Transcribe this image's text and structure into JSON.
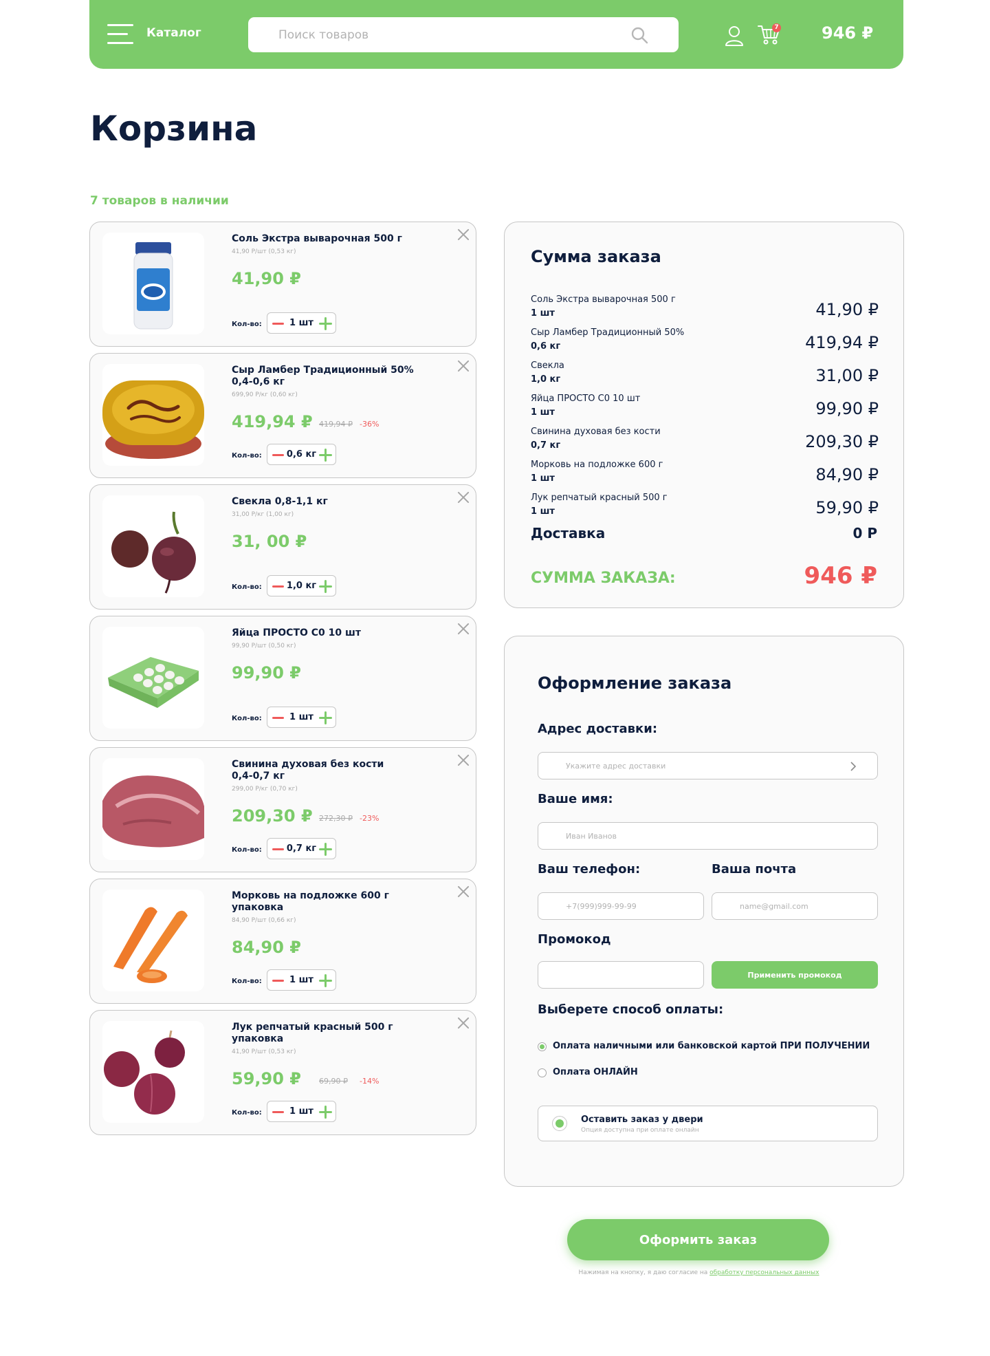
{
  "header": {
    "catalog_label": "Каталог",
    "search_placeholder": "Поиск товаров",
    "cart_count": "7",
    "total": "946 ₽"
  },
  "page": {
    "title": "Корзина",
    "stock_text": "7 товаров в наличии"
  },
  "cart": {
    "qty_label": "Кол-во:",
    "items": [
      {
        "name": "Соль Экстра выварочная 500 г",
        "subline": "",
        "unit": "41,90 Р/шт (0,53 кг)",
        "price": "41,90 ₽",
        "old_price": "",
        "discount": "",
        "qty": "1 шт"
      },
      {
        "name": "Сыр Ламбер Традиционный 50%",
        "subline": "0,4-0,6 кг",
        "unit": "699,90 Р/кг (0,60 кг)",
        "price": "419,94 ₽",
        "old_price": "419,94 ₽",
        "discount": "-36%",
        "qty": "0,6 кг"
      },
      {
        "name": "Свекла 0,8-1,1 кг",
        "subline": "",
        "unit": "31,00 Р/кг (1,00 кг)",
        "price": "31, 00 ₽",
        "old_price": "",
        "discount": "",
        "qty": "1,0 кг"
      },
      {
        "name": "Яйца ПРОСТО С0 10 шт",
        "subline": "",
        "unit": "99,90 Р/шт (0,50 кг)",
        "price": "99,90 ₽",
        "old_price": "",
        "discount": "",
        "qty": "1 шт"
      },
      {
        "name": "Свинина духовая без кости",
        "subline": "0,4-0,7 кг",
        "unit": "299,00 Р/кг (0,70 кг)",
        "price": "209,30 ₽",
        "old_price": "272,30 ₽",
        "discount": "-23%",
        "qty": "0,7 кг"
      },
      {
        "name": "Морковь на подложке 600 г",
        "subline": "упаковка",
        "unit": "84,90 Р/шт (0,66 кг)",
        "price": "84,90 ₽",
        "old_price": "",
        "discount": "",
        "qty": "1 шт"
      },
      {
        "name": "Лук репчатый красный 500 г",
        "subline": "упаковка",
        "unit": "41,90 Р/шт (0,53 кг)",
        "price": "59,90 ₽",
        "old_price": "69,90 ₽",
        "discount": "-14%",
        "qty": "1 шт"
      }
    ]
  },
  "summary": {
    "title": "Сумма заказа",
    "rows": [
      {
        "name": "Соль Экстра выварочная 500 г",
        "qty": "1 шт",
        "price": "41,90 ₽"
      },
      {
        "name": "Сыр Ламбер Традиционный 50%",
        "qty": "0,6 кг",
        "price": "419,94 ₽"
      },
      {
        "name": "Свекла",
        "qty": "1,0 кг",
        "price": "31,00 ₽"
      },
      {
        "name": "Яйца ПРОСТО С0 10 шт",
        "qty": "1 шт",
        "price": "99,90 ₽"
      },
      {
        "name": "Свинина духовая без кости",
        "qty": "0,7 кг",
        "price": "209,30 ₽"
      },
      {
        "name": "Морковь на подложке 600 г",
        "qty": "1 шт",
        "price": "84,90 ₽"
      },
      {
        "name": "Лук репчатый красный 500 г",
        "qty": "1 шт",
        "price": "59,90 ₽"
      }
    ],
    "delivery_label": "Доставка",
    "delivery_value": "0 Р",
    "total_label": "СУММА ЗАКАЗА:",
    "total_value": "946 ₽"
  },
  "checkout": {
    "title": "Оформление заказа",
    "address_label": "Адрес доставки:",
    "address_placeholder": "Укажите адрес доставки",
    "name_label": "Ваше имя:",
    "name_placeholder": "Иван Иванов",
    "phone_label": "Ваш телефон:",
    "phone_placeholder": "+7(999)999-99-99",
    "email_label": "Ваша почта",
    "email_placeholder": "name@gmail.com",
    "promo_label": "Промокод",
    "promo_value": "",
    "promo_button": "Применить промокод",
    "payment_label": "Выберете способ оплаты:",
    "payment_cash": "Оплата наличными или банковской картой ПРИ ПОЛУЧЕНИИ",
    "payment_online": "Оплата ОНЛАЙН",
    "door_title": "Оставить заказ у двери",
    "door_sub": "Опция доступна при оплате онлайн"
  },
  "submit": {
    "label": "Оформить заказ",
    "consent_text": "Нажимая на кнопку, я даю согласие на ",
    "consent_link": "обработку персональных данных"
  },
  "colors": {
    "accent_green": "#7ccb6a",
    "accent_red": "#ef5a5a",
    "text_dark": "#0f1e3d"
  }
}
